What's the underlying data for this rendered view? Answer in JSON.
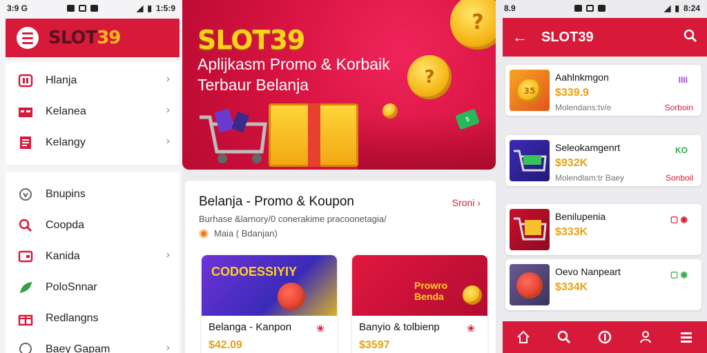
{
  "left_status": {
    "time": "3:9 G",
    "right": "1:5:9"
  },
  "left_header": {
    "logo_slot": "SLOT",
    "logo_num": "39"
  },
  "nav": {
    "group1": [
      {
        "label": "Hlanja",
        "icon": "shop-icon"
      },
      {
        "label": "Kelanea",
        "icon": "store-icon"
      },
      {
        "label": "Kelangy",
        "icon": "list-icon"
      }
    ],
    "group2": [
      {
        "label": "Bnupins",
        "icon": "shield-icon"
      },
      {
        "label": "Coopda",
        "icon": "search-icon"
      },
      {
        "label": "Kanida",
        "icon": "wallet-icon"
      },
      {
        "label": "PoloSnnar",
        "icon": "leaf-icon"
      },
      {
        "label": "Redlangns",
        "icon": "gift-icon"
      },
      {
        "label": "Baey Gapam",
        "icon": "chat-icon"
      }
    ]
  },
  "hero": {
    "title": "SLOT39",
    "subtitle_line1": "Aplijkasm Promo & Korbaik",
    "subtitle_line2": "Terbaur Belanja",
    "coin_text": "?"
  },
  "promo": {
    "title": "Belanja - Promo & Koupon",
    "see_all": "Sroni",
    "desc": "Burhase &larnory/0 conerakime pracoonetagia/",
    "meta": "Maia ( Bdanjan)",
    "cards": [
      {
        "banner": "CODOESSIYIY",
        "title": "Belanga - Kanpon",
        "price": "$42.09"
      },
      {
        "banner": "Prowro Benda",
        "title": "Banyio & tolbienp",
        "price": "$3597"
      }
    ]
  },
  "right_status": {
    "time": "8.9",
    "right": "8:24"
  },
  "right_header": {
    "title": "SLOT39"
  },
  "products": [
    {
      "name": "Aahlnkmgon",
      "price": "$339.9",
      "meta": "Molendans:tv/e",
      "tag": "IIII",
      "action": "Sorboin"
    },
    {
      "name": "Seleokamgenrt",
      "price": "$932K",
      "meta": "Molendlam:tr Baey",
      "tag": "KO",
      "action": "Sonboil"
    },
    {
      "name": "Benilupenia",
      "price": "$333K",
      "meta": "",
      "tag": "",
      "action": ""
    },
    {
      "name": "Oevo Nanpeart",
      "price": "$334K",
      "meta": "",
      "tag": "",
      "action": ""
    }
  ],
  "colors": {
    "brand_red": "#d71a3a",
    "gold": "#f6b81a",
    "price": "#e6a116"
  }
}
